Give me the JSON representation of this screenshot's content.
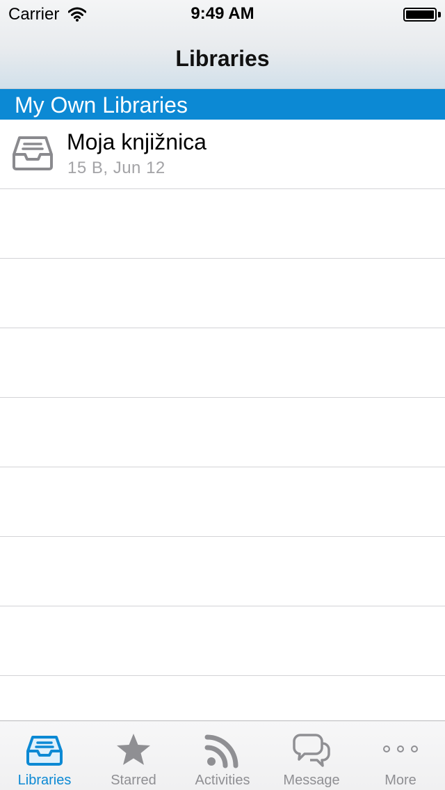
{
  "status_bar": {
    "carrier": "Carrier",
    "time": "9:49 AM",
    "wifi_icon": "wifi-icon",
    "battery_icon": "battery-icon",
    "battery_level": 1.0
  },
  "nav": {
    "title": "Libraries"
  },
  "section": {
    "title": "My Own Libraries",
    "color": "#0c89d4"
  },
  "libraries": [
    {
      "name": "Moja knjižnica",
      "meta": "15 B, Jun 12",
      "icon": "inbox-tray-icon"
    }
  ],
  "tabbar": {
    "active_color": "#0c89d4",
    "inactive_color": "#8f8f93",
    "tabs": [
      {
        "label": "Libraries",
        "icon": "inbox-tray-icon",
        "active": true
      },
      {
        "label": "Starred",
        "icon": "star-icon",
        "active": false
      },
      {
        "label": "Activities",
        "icon": "rss-feed-icon",
        "active": false
      },
      {
        "label": "Message",
        "icon": "chat-bubbles-icon",
        "active": false
      },
      {
        "label": "More",
        "icon": "more-dots-icon",
        "active": false
      }
    ]
  }
}
